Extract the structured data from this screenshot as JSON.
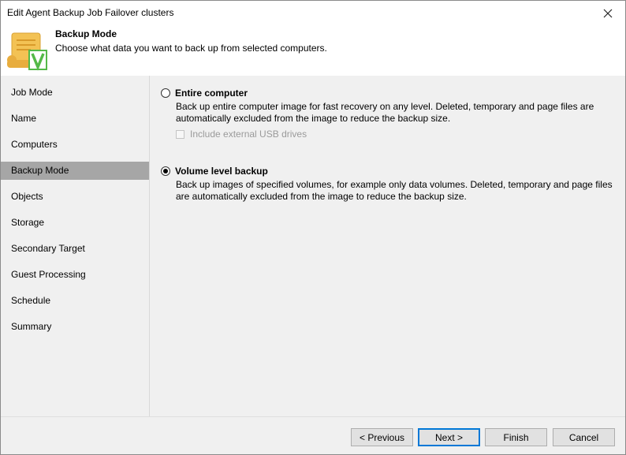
{
  "window": {
    "title": "Edit Agent Backup Job Failover clusters"
  },
  "header": {
    "title": "Backup Mode",
    "subtitle": "Choose what data you want to back up from selected computers.",
    "icon": "scroll-checkmark-icon"
  },
  "sidebar": {
    "items": [
      {
        "label": "Job Mode"
      },
      {
        "label": "Name"
      },
      {
        "label": "Computers"
      },
      {
        "label": "Backup Mode"
      },
      {
        "label": "Objects"
      },
      {
        "label": "Storage"
      },
      {
        "label": "Secondary Target"
      },
      {
        "label": "Guest Processing"
      },
      {
        "label": "Schedule"
      },
      {
        "label": "Summary"
      }
    ],
    "active": "Backup Mode"
  },
  "options": {
    "entire": {
      "label": "Entire computer",
      "desc1": "Back up entire computer image for fast recovery on any level. Deleted, temporary and page files are",
      "desc2": "automatically excluded from the image to reduce the backup size.",
      "selected": false,
      "usb": {
        "label": "Include external USB drives",
        "checked": false,
        "enabled": false
      }
    },
    "volume": {
      "label": "Volume level backup",
      "desc1": "Back up images of specified volumes, for example only data volumes. Deleted, temporary and page files",
      "desc2": "are automatically excluded from the image to reduce the backup size.",
      "selected": true
    }
  },
  "footer": {
    "previous": "< Previous",
    "next": "Next >",
    "finish": "Finish",
    "cancel": "Cancel"
  },
  "colors": {
    "accent": "#0078d7",
    "active_nav": "#a6a6a6"
  }
}
